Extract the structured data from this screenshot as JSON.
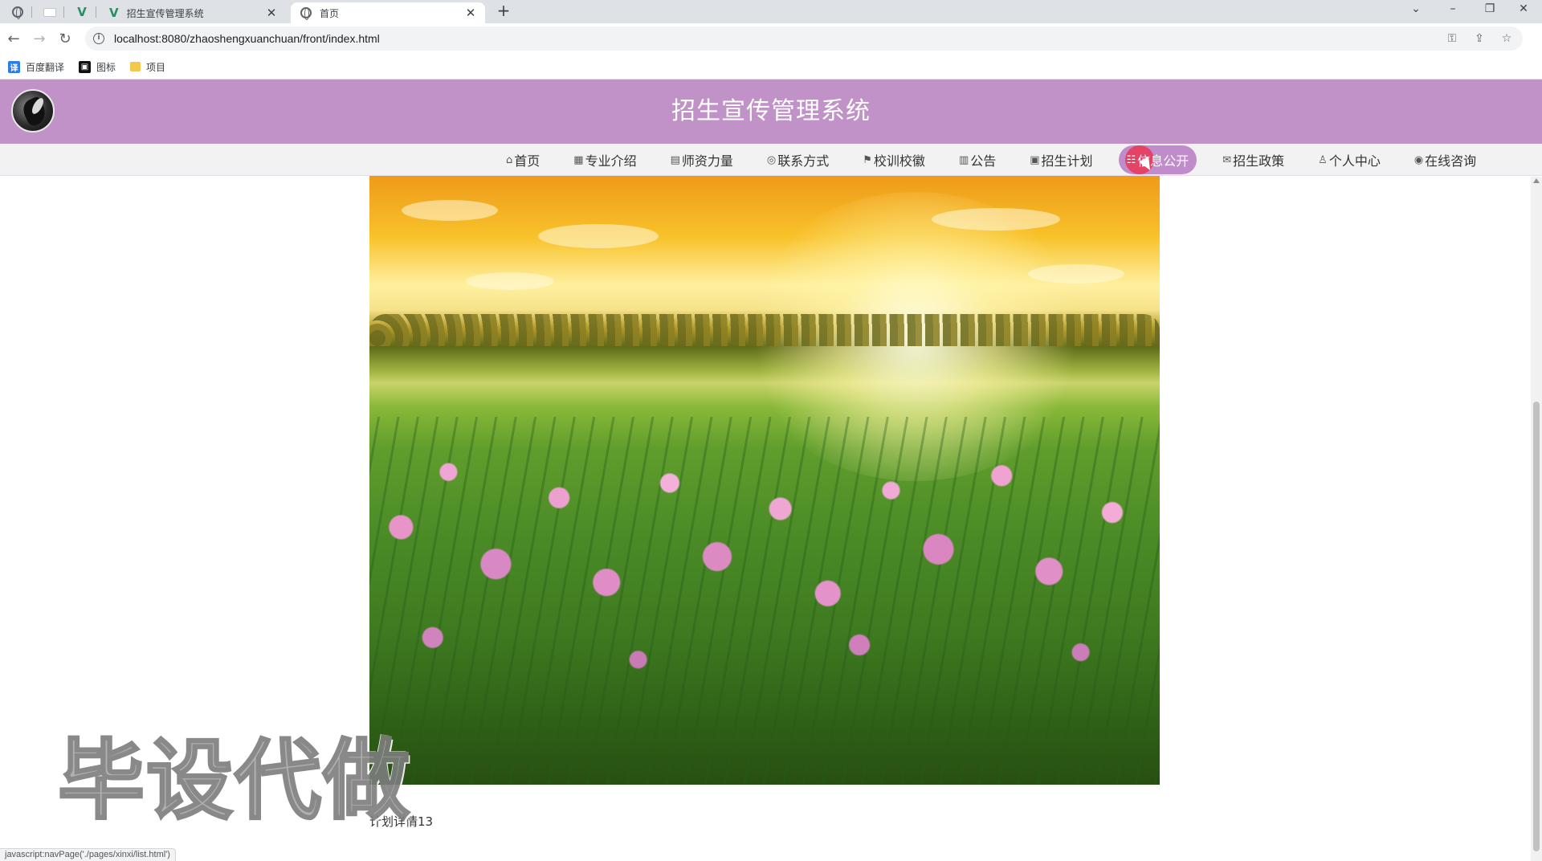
{
  "browser": {
    "tabs": [
      {
        "title": "招生宣传管理系统",
        "active": false
      },
      {
        "title": "首页",
        "active": true
      }
    ],
    "url": "localhost:8080/zhaoshengxuanchuan/front/index.html",
    "bookmarks": [
      {
        "label": "百度翻译",
        "icon": "translate-icon"
      },
      {
        "label": "图标",
        "icon": "photo-icon"
      },
      {
        "label": "项目",
        "icon": "folder-icon"
      }
    ],
    "status_text": "javascript:navPage('./pages/xinxi/list.html')"
  },
  "site": {
    "title": "招生宣传管理系统",
    "nav": [
      {
        "label": "首页",
        "icon": "⌂"
      },
      {
        "label": "专业介绍",
        "icon": "▦"
      },
      {
        "label": "师资力量",
        "icon": "▤"
      },
      {
        "label": "联系方式",
        "icon": "◎"
      },
      {
        "label": "校训校徽",
        "icon": "⚑"
      },
      {
        "label": "公告",
        "icon": "▥"
      },
      {
        "label": "招生计划",
        "icon": "▣"
      },
      {
        "label": "信息公开",
        "icon": "☷",
        "active": true
      },
      {
        "label": "招生政策",
        "icon": "✉"
      },
      {
        "label": "个人中心",
        "icon": "♙"
      },
      {
        "label": "在线咨询",
        "icon": "◉"
      }
    ]
  },
  "content": {
    "caption": "计划详情13"
  },
  "overlay": {
    "watermark": "毕设代做"
  },
  "colors": {
    "header_bg": "#c192c8",
    "nav_bg": "#f2f2f2",
    "active_nav": "#c18ccc",
    "click_indicator": "#ec304e"
  }
}
